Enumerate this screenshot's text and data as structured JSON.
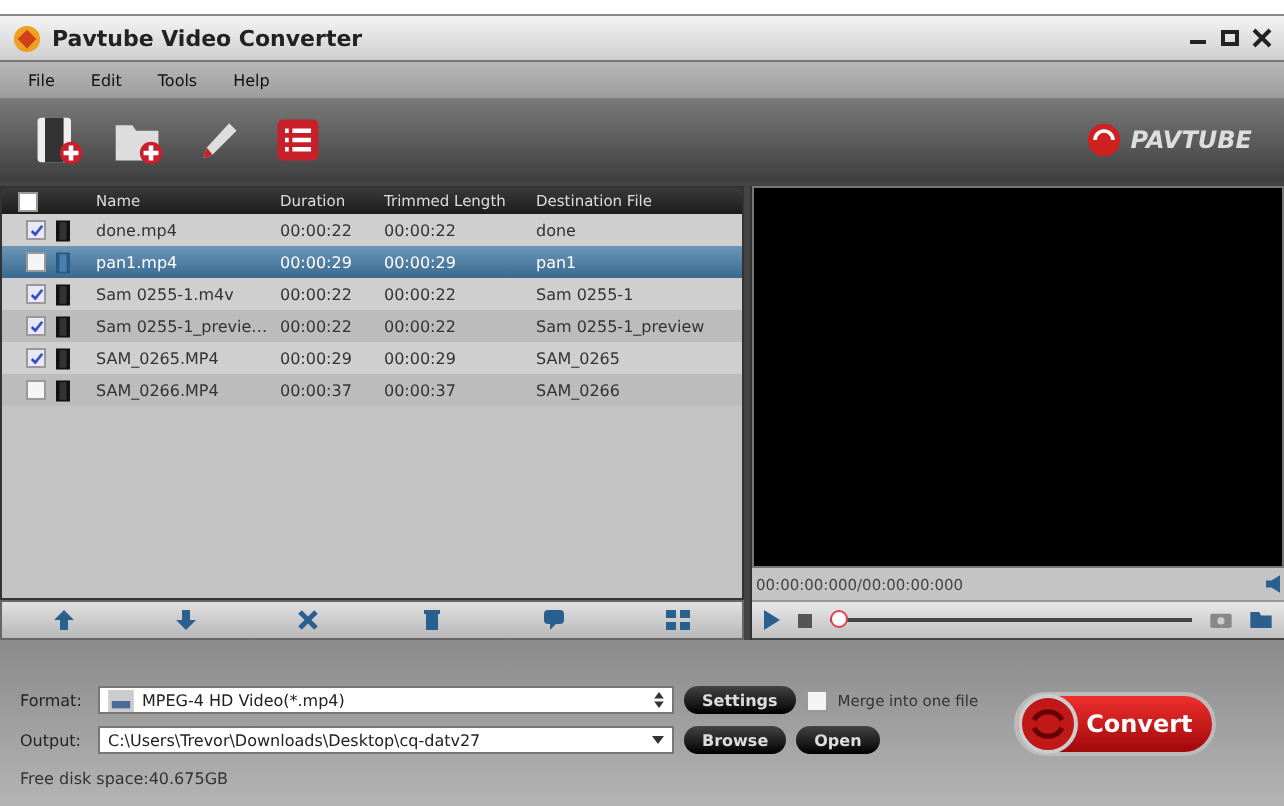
{
  "window": {
    "title": "Pavtube Video Converter"
  },
  "menu": [
    "File",
    "Edit",
    "Tools",
    "Help"
  ],
  "logo": {
    "text": "PAVTUBE"
  },
  "table": {
    "header_checked": false,
    "columns": [
      "Name",
      "Duration",
      "Trimmed Length",
      "Destination File"
    ],
    "rows": [
      {
        "checked": true,
        "selected": false,
        "cells": [
          "done.mp4",
          "00:00:22",
          "00:00:22",
          "done"
        ]
      },
      {
        "checked": false,
        "selected": true,
        "cells": [
          "pan1.mp4",
          "00:00:29",
          "00:00:29",
          "pan1"
        ]
      },
      {
        "checked": true,
        "selected": false,
        "cells": [
          "Sam 0255-1.m4v",
          "00:00:22",
          "00:00:22",
          "Sam 0255-1"
        ]
      },
      {
        "checked": true,
        "selected": false,
        "cells": [
          "Sam 0255-1_previe…",
          "00:00:22",
          "00:00:22",
          "Sam 0255-1_preview"
        ]
      },
      {
        "checked": true,
        "selected": false,
        "cells": [
          "SAM_0265.MP4",
          "00:00:29",
          "00:00:29",
          "SAM_0265"
        ]
      },
      {
        "checked": false,
        "selected": false,
        "cells": [
          "SAM_0266.MP4",
          "00:00:37",
          "00:00:37",
          "SAM_0266"
        ]
      }
    ]
  },
  "preview": {
    "time": "00:00:00:000/00:00:00:000",
    "level": 0
  },
  "format": {
    "label": "Format:",
    "value": "MPEG-4 HD Video(*.mp4)",
    "settings": "Settings",
    "merge_label": "Merge into one file",
    "merge_checked": false
  },
  "output": {
    "label": "Output:",
    "value": "C:\\Users\\Trevor\\Downloads\\Desktop\\cq-datv27",
    "browse": "Browse",
    "open": "Open"
  },
  "convert": "Convert",
  "status_bar": "Free disk space:40.675GB"
}
